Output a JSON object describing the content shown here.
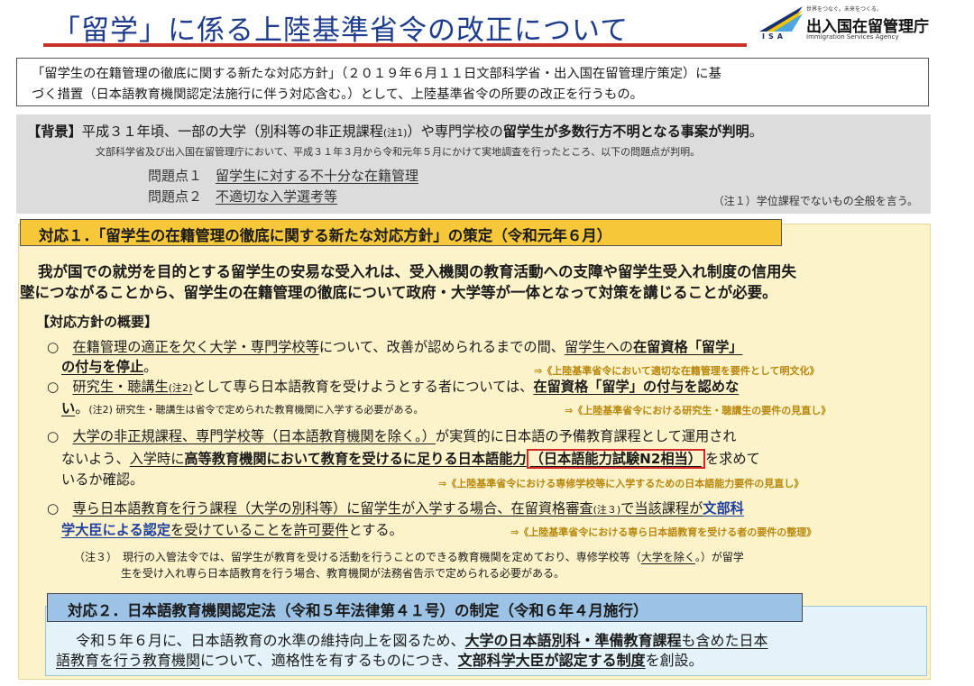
{
  "header": {
    "title": "「留学」に係る上陸基準省令の改正について",
    "logo": {
      "tagline": "世界をつなぐ。未来をつくる。",
      "name": "出入国在留管理庁",
      "english": "Immigration Services Agency",
      "abbr": "ISA"
    }
  },
  "intro": {
    "line1": "「留学生の在籍管理の徹底に関する新たな対応方針」（２０１９年６月１１日文部科学省・出入国在留管理庁策定）に基",
    "line2": "づく措置（日本語教育機関認定法施行に伴う対応含む。）として、上陸基準省令の所要の改正を行うもの。"
  },
  "background": {
    "label": "【背景】",
    "l1a": "平成３１年頃、一部の大学（別科等の非正規課程",
    "l1note": "(注1)",
    "l1b": "）や専門学校の",
    "l1bold": "留学生が多数行方不明となる事案が判明",
    "l1end": "。",
    "l2": "文部科学省及び出入国在留管理庁において、平成３１年３月から令和元年５月にかけて実地調査を行ったところ、以下の問題点が判明。",
    "p1_label": "問題点１",
    "p1_text": "留学生に対する不十分な在籍管理",
    "p2_label": "問題点２",
    "p2_text": "不適切な入学選考等",
    "note": "（注１）学位課程でないもの全般を言う。"
  },
  "section1": {
    "header": "対応１．「留学生の在籍管理の徹底に関する新たな対応方針」の策定（令和元年６月）",
    "body1": "我が国での就労を目的とする留学生の安易な受入れは、受入機関の教育活動への支障や留学生受入れ制度の信用失",
    "body2": "墜につながることから、留学生の在籍管理の徹底について政府・大学等が一体となって対策を講じることが必要。",
    "overview": "【対応方針の概要】",
    "b1a": "在籍管理の適正を欠く大学・専門学校等",
    "b1b": "について、改善が認められるまでの間、",
    "b1c": "留学生への",
    "b1d": "在留資格「留学」",
    "b1e": "の付与を停止",
    "b1f": "。",
    "b1ref": "⇒《上陸基準省令において適切な在籍管理を要件として明文化》",
    "b2a": "研究生・聴講生",
    "b2note": "(注2)",
    "b2b": "として専ら日本語教育を受けようとする者については、",
    "b2c": "在留資格「留学」の付与を認めな",
    "b2d": "い",
    "b2e": "。",
    "b2small": "(注2) 研究生・聴講生は省令で定められた教育機関に入学する必要がある。",
    "b2ref": "⇒《上陸基準省令における研究生・聴講生の要件の見直し》",
    "b3a": "大学の非正規課程、専門学校等（日本語教育機関を除く。）",
    "b3b": "が実質的に日本語の予備教育課程として運用され",
    "b3c": "ないよう、",
    "b3d": "入学時に",
    "b3e": "高等教育機関において教育を受けるに足りる日本語能力",
    "b3f": "（日本語能力試験N2相当）",
    "b3g": "を求めて",
    "b3h": "いるか確認",
    "b3i": "。",
    "b3ref": "⇒《上陸基準省令における専修学校等に入学するための日本語能力要件の見直し》",
    "b4a": "専ら日本語教育を行う課程（大学の別科等）に留学生が入学する場合、在留資格審査",
    "b4note": "(注３)",
    "b4b": "で当該課程が",
    "b4c": "文部科",
    "b4d": "学大臣による認定",
    "b4e": "を受けていることを許可要件",
    "b4f": "とする。",
    "b4ref": "⇒《上陸基準省令における専ら日本語教育を受ける者の要件の整理》",
    "note3a": "（注３）　現行の入管法令では、留学生が教育を受ける活動を行うことのできる教育機関を定めており、専修学校等（",
    "note3u": "大学を除く",
    "note3b": "。）が留学",
    "note3c": "生を受け入れ専ら日本語教育を行う場合、教育機関が法務省告示で定められる必要がある。",
    "bullet": "○"
  },
  "section2": {
    "header": "対応２．日本語教育機関認定法（令和５年法律第４１号）の制定（令和６年４月施行）",
    "l1a": "令和５年６月に、日本語教育の水準の維持向上を図るため、",
    "l1b": "大学の日本語別科・準備教育課程",
    "l1c": "も含めた日本",
    "l2a": "語教育を行う教育機関",
    "l2b": "について、適格性を有するものにつき、",
    "l2c": "文部科学大臣が認定する制度",
    "l2d": "を創設。"
  }
}
